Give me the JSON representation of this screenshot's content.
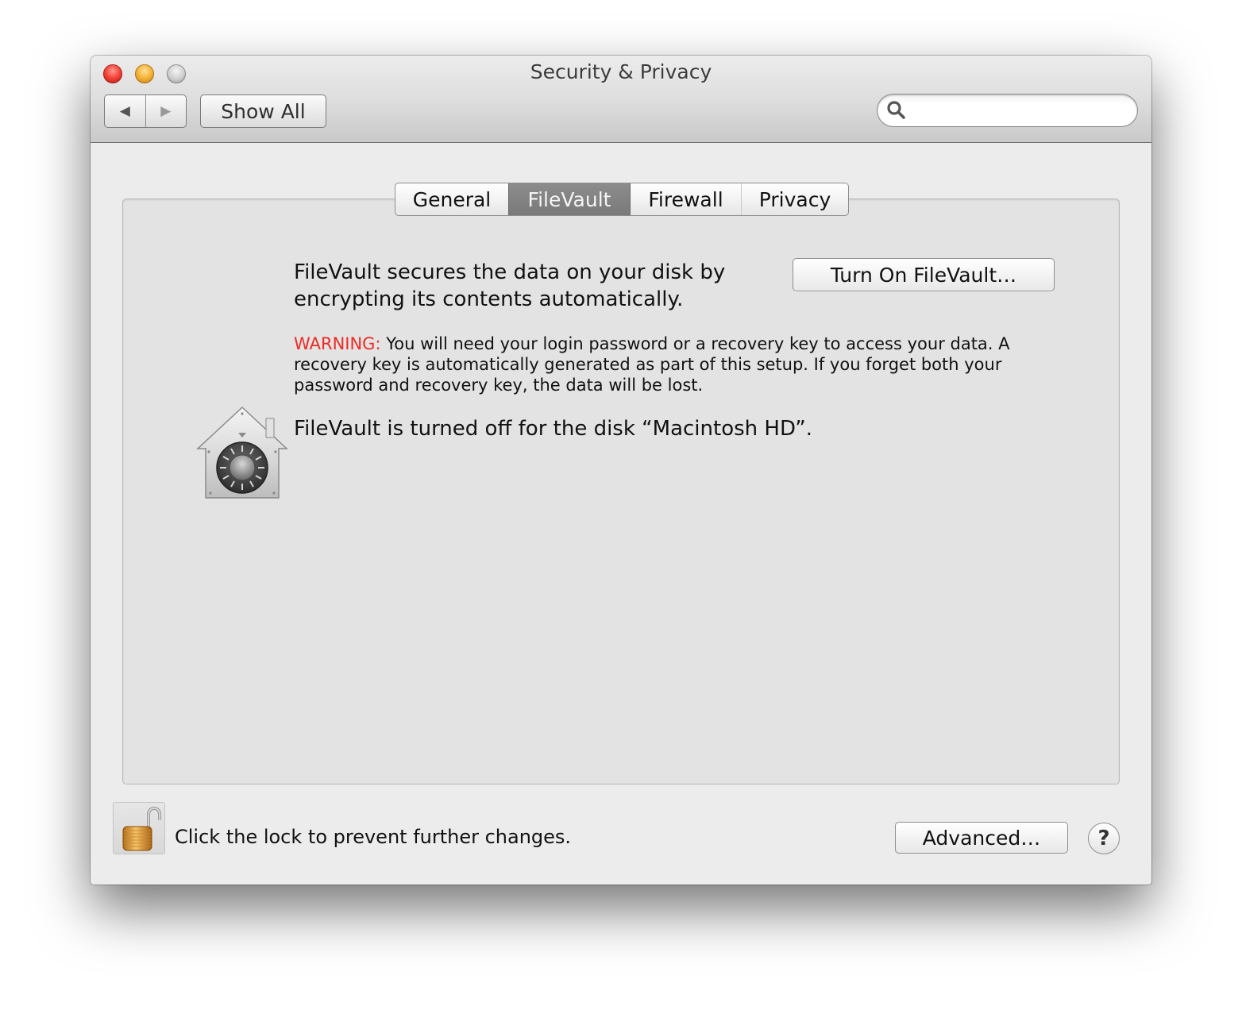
{
  "window": {
    "title": "Security & Privacy",
    "controls": [
      "close",
      "minimize",
      "zoom"
    ]
  },
  "toolbar": {
    "back_icon": "◀",
    "forward_icon": "▶",
    "show_all_label": "Show All",
    "search": {
      "value": "",
      "placeholder": "",
      "icon": "search-icon"
    }
  },
  "tabs": [
    {
      "label": "General",
      "selected": false
    },
    {
      "label": "FileVault",
      "selected": true
    },
    {
      "label": "Firewall",
      "selected": false
    },
    {
      "label": "Privacy",
      "selected": false
    }
  ],
  "filevault": {
    "icon": "filevault-house-safe-icon",
    "intro_line1": "FileVault secures the data on your disk by",
    "intro_line2": "encrypting its contents automatically.",
    "turn_on_label": "Turn On FileVault…",
    "warning_label": "WARNING:",
    "warning_text": " You will need your login password or a recovery key to access your data. A recovery key is automatically generated as part of this setup. If you forget both your password and recovery key, the data will be lost.",
    "status_text": "FileVault is turned off for the disk “Macintosh HD”."
  },
  "footer": {
    "lock_icon": "unlocked-padlock-icon",
    "lock_text": "Click the lock to prevent further changes.",
    "advanced_label": "Advanced…",
    "help_label": "?"
  },
  "colors": {
    "warning": "#ee2a24",
    "selected_tab": "#838383",
    "window_bg": "#ececec",
    "panel_bg": "#e3e3e3"
  }
}
